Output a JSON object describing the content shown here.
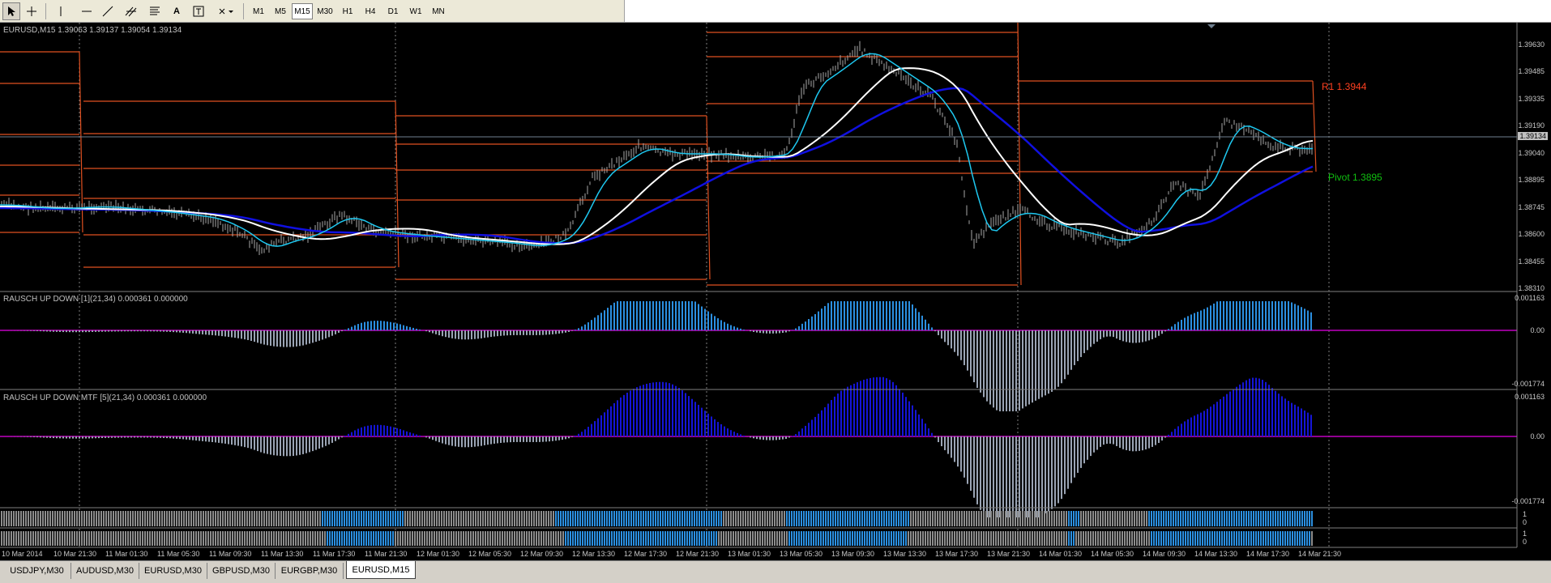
{
  "window": {
    "symbol_line": "EURUSD,M15  1.39063 1.39137 1.39054 1.39134"
  },
  "toolbar": {
    "timeframes": [
      "M1",
      "M5",
      "M15",
      "M30",
      "H1",
      "H4",
      "D1",
      "W1",
      "MN"
    ],
    "active_timeframe": "M15"
  },
  "main_chart": {
    "price_labels": [
      "1.39630",
      "1.39485",
      "1.39335",
      "1.39190",
      "1.39040",
      "1.38895",
      "1.38745",
      "1.38600",
      "1.38455",
      "1.38310"
    ],
    "current_price": "1.39134",
    "r1_label": "R1 1.3944",
    "pivot_label": "Pivot 1.3895",
    "colors": {
      "candles": "#a8a8a8",
      "ma_fast": "#1ec8f0",
      "ma_mid": "#ffffff",
      "ma_slow": "#1010e0",
      "pivot_lines": "#e05020",
      "r1": "#ff4020",
      "pivot": "#10c010"
    }
  },
  "indicator1": {
    "label": "RAUSCH UP DOWN [1](21,34) 0.000361 0.000000",
    "levels": [
      "0.001163",
      "0.00",
      "-0.001774"
    ],
    "colors": {
      "up": "#2b8fe0",
      "down": "#9aa4b4",
      "zero": "#c000c0"
    }
  },
  "indicator2": {
    "label": "RAUSCH UP DOWN MTF [5](21,34) 0.000361 0.000000",
    "levels": [
      "0.001163",
      "0.00",
      "-0.001774"
    ],
    "colors": {
      "up": "#1515d8",
      "down": "#9aa4b4",
      "zero": "#c000c0"
    }
  },
  "strips": {
    "levels": [
      "1",
      "0",
      "1",
      "0"
    ]
  },
  "time_axis": [
    "10 Mar 2014",
    "10 Mar 21:30",
    "11 Mar 01:30",
    "11 Mar 05:30",
    "11 Mar 09:30",
    "11 Mar 13:30",
    "11 Mar 17:30",
    "11 Mar 21:30",
    "12 Mar 01:30",
    "12 Mar 05:30",
    "12 Mar 09:30",
    "12 Mar 13:30",
    "12 Mar 17:30",
    "12 Mar 21:30",
    "13 Mar 01:30",
    "13 Mar 05:30",
    "13 Mar 09:30",
    "13 Mar 13:30",
    "13 Mar 17:30",
    "13 Mar 21:30",
    "14 Mar 01:30",
    "14 Mar 05:30",
    "14 Mar 09:30",
    "14 Mar 13:30",
    "14 Mar 17:30",
    "14 Mar 21:30"
  ],
  "tabs": [
    "USDJPY,M30",
    "AUDUSD,M30",
    "EURUSD,M30",
    "GBPUSD,M30",
    "EURGBP,M30",
    "EURUSD,M15"
  ],
  "active_tab": "EURUSD,M15"
}
